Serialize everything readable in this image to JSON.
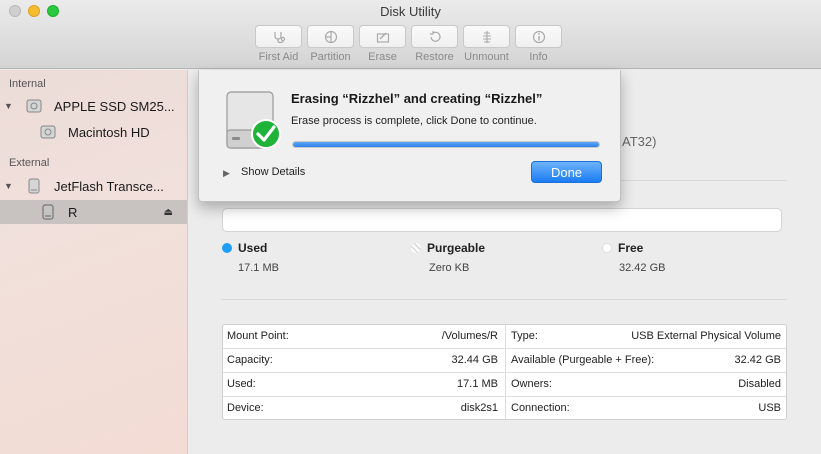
{
  "window": {
    "title": "Disk Utility"
  },
  "toolbar": {
    "items": [
      {
        "label": "First Aid",
        "icon": "stethoscope-icon"
      },
      {
        "label": "Partition",
        "icon": "partition-icon"
      },
      {
        "label": "Erase",
        "icon": "erase-icon"
      },
      {
        "label": "Restore",
        "icon": "restore-icon"
      },
      {
        "label": "Unmount",
        "icon": "unmount-icon"
      },
      {
        "label": "Info",
        "icon": "info-icon"
      }
    ]
  },
  "sidebar": {
    "internal_header": "Internal",
    "external_header": "External",
    "items": [
      {
        "label": "APPLE SSD SM25..."
      },
      {
        "label": "Macintosh HD"
      },
      {
        "label": "JetFlash Transce..."
      },
      {
        "label": "R"
      }
    ]
  },
  "main": {
    "format_fragment": "AT32)",
    "usage": {
      "used": {
        "label": "Used",
        "value": "17.1 MB",
        "color": "#1e9ef6"
      },
      "purgeable": {
        "label": "Purgeable",
        "value": "Zero KB"
      },
      "free": {
        "label": "Free",
        "value": "32.42 GB",
        "color": "#ffffff"
      }
    },
    "info": {
      "left": [
        {
          "key": "Mount Point:",
          "value": "/Volumes/R"
        },
        {
          "key": "Capacity:",
          "value": "32.44 GB"
        },
        {
          "key": "Used:",
          "value": "17.1 MB"
        },
        {
          "key": "Device:",
          "value": "disk2s1"
        }
      ],
      "right": [
        {
          "key": "Type:",
          "value": "USB External Physical Volume"
        },
        {
          "key": "Available (Purgeable + Free):",
          "value": "32.42 GB"
        },
        {
          "key": "Owners:",
          "value": "Disabled"
        },
        {
          "key": "Connection:",
          "value": "USB"
        }
      ]
    }
  },
  "dialog": {
    "title": "Erasing “Rizzhel” and creating “Rizzhel”",
    "message": "Erase process is complete, click Done to continue.",
    "progress": 1.0,
    "details_label": "Show Details",
    "done_label": "Done",
    "accent": "#1c7cf4"
  }
}
